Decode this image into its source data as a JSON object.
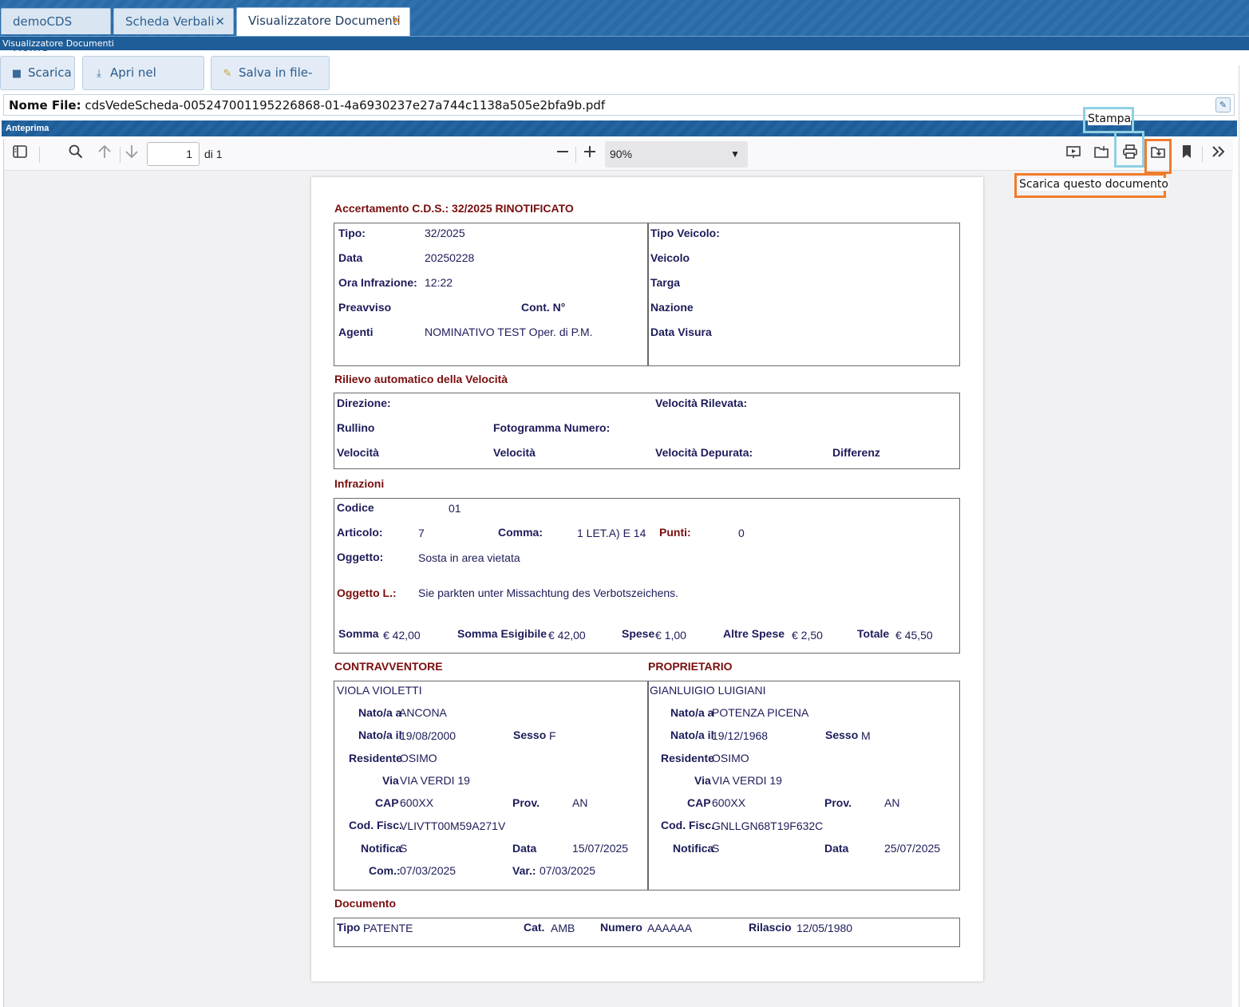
{
  "tabs": [
    {
      "label": "demoCDS Home"
    },
    {
      "label": "Scheda Verbali"
    },
    {
      "label": "Visualizzatore Documenti"
    }
  ],
  "title_bar": "Visualizzatore Documenti",
  "toolbar": {
    "download": "Scarica",
    "open_system": "Apri nel sistema",
    "save_filebox": "Salva in file-box"
  },
  "file": {
    "label": "Nome File:",
    "name": "cdsVedeScheda-005247001195226868-01-4a6930237e27a744c1138a505e2bfa9b.pdf"
  },
  "section_title": "Anteprima",
  "viewer": {
    "page_number": "1",
    "page_total": "di 1",
    "zoom": "90%",
    "tooltip_print": "Stampa",
    "tooltip_download": "Scarica questo documento"
  },
  "doc": {
    "title": "Accertamento C.D.S.: 32/2025 RINOTIFICATO",
    "left_block": {
      "tipo_label": "Tipo:",
      "tipo": "32/2025",
      "data_label": "Data",
      "data": "20250228",
      "ora_label": "Ora Infrazione:",
      "ora": "12:22",
      "preavviso_label": "Preavviso",
      "cont_label": "Cont. N°",
      "agenti_label": "Agenti",
      "agenti": "NOMINATIVO TEST Oper. di P.M."
    },
    "right_block": {
      "tipo_veicolo": "Tipo Veicolo:",
      "veicolo": "Veicolo",
      "targa": "Targa",
      "nazione": "Nazione",
      "data_visura": "Data Visura"
    },
    "velocita": {
      "title": "Rilievo automatico della Velocità",
      "direzione": "Direzione:",
      "vel_rilevata": "Velocità Rilevata:",
      "rullino": "Rullino",
      "fotogramma": "Fotogramma Numero:",
      "velocita1": "Velocità",
      "velocita2": "Velocità",
      "vel_depurata": "Velocità Depurata:",
      "differenz": "Differenz"
    },
    "infrazioni": {
      "title": "Infrazioni",
      "codice_label": "Codice",
      "codice": "01",
      "articolo_label": "Articolo:",
      "articolo": "7",
      "comma_label": "Comma:",
      "comma": "1 LET.A) E 14",
      "punti_label": "Punti:",
      "punti": "0",
      "oggetto_label": "Oggetto:",
      "oggetto": "Sosta in area vietata",
      "oggetto_l_label": "Oggetto L.:",
      "oggetto_l": "Sie parkten unter Missachtung des Verbotszeichens.",
      "somma_label": "Somma",
      "somma": "€ 42,00",
      "somma_esig_label": "Somma Esigibile",
      "somma_esig": "€ 42,00",
      "spese_label": "Spese",
      "spese": "€ 1,00",
      "altre_label": "Altre Spese",
      "altre": "€ 2,50",
      "totale_label": "Totale",
      "totale": "€ 45,50"
    },
    "contravventore": {
      "title": "CONTRAVVENTORE",
      "nome": "VIOLA VIOLETTI",
      "natoa_label": "Nato/a a",
      "natoa": "ANCONA",
      "natoil_label": "Nato/a il",
      "natoil": "19/08/2000",
      "sesso_label": "Sesso",
      "sesso": "F",
      "residente_label": "Residente",
      "residente": "OSIMO",
      "via_label": "Via",
      "via": "VIA VERDI 19",
      "cap_label": "CAP",
      "cap": "600XX",
      "prov_label": "Prov.",
      "prov": "AN",
      "codfisc_label": "Cod. Fisc.",
      "codfisc": "VLIVTT00M59A271V",
      "notifica_label": "Notifica",
      "notifica": "S",
      "data_label": "Data",
      "data": "15/07/2025",
      "com_label": "Com.:",
      "com": "07/03/2025",
      "var_label": "Var.:",
      "var": "07/03/2025"
    },
    "proprietario": {
      "title": "PROPRIETARIO",
      "nome": "GIANLUIGIO LUIGIANI",
      "natoa_label": "Nato/a a",
      "natoa": "POTENZA PICENA",
      "natoil_label": "Nato/a il",
      "natoil": "19/12/1968",
      "sesso_label": "Sesso",
      "sesso": "M",
      "residente_label": "Residente",
      "residente": "OSIMO",
      "via_label": "Via",
      "via": "VIA VERDI 19",
      "cap_label": "CAP",
      "cap": "600XX",
      "prov_label": "Prov.",
      "prov": "AN",
      "codfisc_label": "Cod. Fisc.",
      "codfisc": "GNLLGN68T19F632C",
      "notifica_label": "Notifica",
      "notifica": "S",
      "data_label": "Data",
      "data": "25/07/2025"
    },
    "documento": {
      "title": "Documento",
      "tipo_label": "Tipo",
      "tipo": "PATENTE",
      "cat_label": "Cat.",
      "cat": "AMB",
      "numero_label": "Numero",
      "numero": "AAAAAA",
      "rilascio_label": "Rilascio",
      "rilascio": "12/05/1980"
    }
  }
}
